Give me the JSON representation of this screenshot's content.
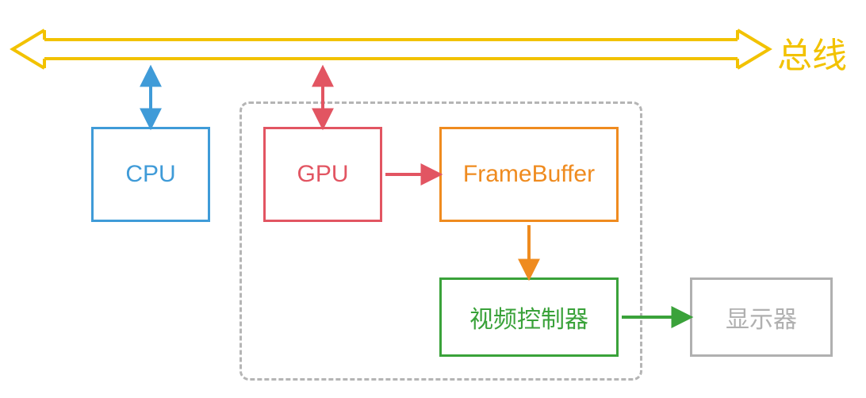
{
  "bus": {
    "label": "总线",
    "color": "#f2c200"
  },
  "nodes": {
    "cpu": {
      "label": "CPU",
      "color": "#3f9bd8"
    },
    "gpu": {
      "label": "GPU",
      "color": "#e25562"
    },
    "framebuffer": {
      "label": "FrameBuffer",
      "color": "#ef8b1f"
    },
    "video_ctrl": {
      "label": "视频控制器",
      "color": "#3aa23a"
    },
    "display": {
      "label": "显示器",
      "color": "#b0b0b0"
    }
  },
  "arrows": {
    "cpu_bus": {
      "color": "#3f9bd8",
      "bidirectional": true
    },
    "gpu_bus": {
      "color": "#e25562",
      "bidirectional": true
    },
    "gpu_fb": {
      "color": "#e25562",
      "bidirectional": false
    },
    "fb_vc": {
      "color": "#ef8b1f",
      "bidirectional": false
    },
    "vc_display": {
      "color": "#3aa23a",
      "bidirectional": false
    }
  },
  "group": {
    "color": "#b5b5b5"
  }
}
